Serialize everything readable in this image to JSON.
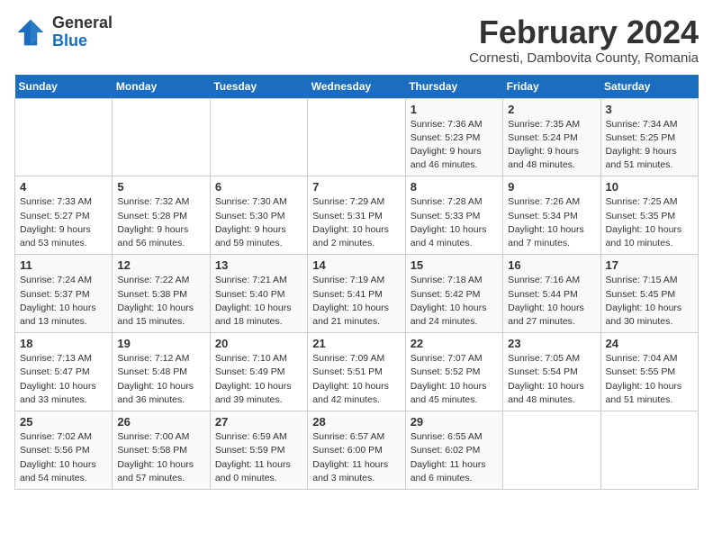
{
  "header": {
    "logo_general": "General",
    "logo_blue": "Blue",
    "month_title": "February 2024",
    "location": "Cornesti, Dambovita County, Romania"
  },
  "calendar": {
    "days_of_week": [
      "Sunday",
      "Monday",
      "Tuesday",
      "Wednesday",
      "Thursday",
      "Friday",
      "Saturday"
    ],
    "weeks": [
      [
        {
          "day": "",
          "detail": ""
        },
        {
          "day": "",
          "detail": ""
        },
        {
          "day": "",
          "detail": ""
        },
        {
          "day": "",
          "detail": ""
        },
        {
          "day": "1",
          "detail": "Sunrise: 7:36 AM\nSunset: 5:23 PM\nDaylight: 9 hours\nand 46 minutes."
        },
        {
          "day": "2",
          "detail": "Sunrise: 7:35 AM\nSunset: 5:24 PM\nDaylight: 9 hours\nand 48 minutes."
        },
        {
          "day": "3",
          "detail": "Sunrise: 7:34 AM\nSunset: 5:25 PM\nDaylight: 9 hours\nand 51 minutes."
        }
      ],
      [
        {
          "day": "4",
          "detail": "Sunrise: 7:33 AM\nSunset: 5:27 PM\nDaylight: 9 hours\nand 53 minutes."
        },
        {
          "day": "5",
          "detail": "Sunrise: 7:32 AM\nSunset: 5:28 PM\nDaylight: 9 hours\nand 56 minutes."
        },
        {
          "day": "6",
          "detail": "Sunrise: 7:30 AM\nSunset: 5:30 PM\nDaylight: 9 hours\nand 59 minutes."
        },
        {
          "day": "7",
          "detail": "Sunrise: 7:29 AM\nSunset: 5:31 PM\nDaylight: 10 hours\nand 2 minutes."
        },
        {
          "day": "8",
          "detail": "Sunrise: 7:28 AM\nSunset: 5:33 PM\nDaylight: 10 hours\nand 4 minutes."
        },
        {
          "day": "9",
          "detail": "Sunrise: 7:26 AM\nSunset: 5:34 PM\nDaylight: 10 hours\nand 7 minutes."
        },
        {
          "day": "10",
          "detail": "Sunrise: 7:25 AM\nSunset: 5:35 PM\nDaylight: 10 hours\nand 10 minutes."
        }
      ],
      [
        {
          "day": "11",
          "detail": "Sunrise: 7:24 AM\nSunset: 5:37 PM\nDaylight: 10 hours\nand 13 minutes."
        },
        {
          "day": "12",
          "detail": "Sunrise: 7:22 AM\nSunset: 5:38 PM\nDaylight: 10 hours\nand 15 minutes."
        },
        {
          "day": "13",
          "detail": "Sunrise: 7:21 AM\nSunset: 5:40 PM\nDaylight: 10 hours\nand 18 minutes."
        },
        {
          "day": "14",
          "detail": "Sunrise: 7:19 AM\nSunset: 5:41 PM\nDaylight: 10 hours\nand 21 minutes."
        },
        {
          "day": "15",
          "detail": "Sunrise: 7:18 AM\nSunset: 5:42 PM\nDaylight: 10 hours\nand 24 minutes."
        },
        {
          "day": "16",
          "detail": "Sunrise: 7:16 AM\nSunset: 5:44 PM\nDaylight: 10 hours\nand 27 minutes."
        },
        {
          "day": "17",
          "detail": "Sunrise: 7:15 AM\nSunset: 5:45 PM\nDaylight: 10 hours\nand 30 minutes."
        }
      ],
      [
        {
          "day": "18",
          "detail": "Sunrise: 7:13 AM\nSunset: 5:47 PM\nDaylight: 10 hours\nand 33 minutes."
        },
        {
          "day": "19",
          "detail": "Sunrise: 7:12 AM\nSunset: 5:48 PM\nDaylight: 10 hours\nand 36 minutes."
        },
        {
          "day": "20",
          "detail": "Sunrise: 7:10 AM\nSunset: 5:49 PM\nDaylight: 10 hours\nand 39 minutes."
        },
        {
          "day": "21",
          "detail": "Sunrise: 7:09 AM\nSunset: 5:51 PM\nDaylight: 10 hours\nand 42 minutes."
        },
        {
          "day": "22",
          "detail": "Sunrise: 7:07 AM\nSunset: 5:52 PM\nDaylight: 10 hours\nand 45 minutes."
        },
        {
          "day": "23",
          "detail": "Sunrise: 7:05 AM\nSunset: 5:54 PM\nDaylight: 10 hours\nand 48 minutes."
        },
        {
          "day": "24",
          "detail": "Sunrise: 7:04 AM\nSunset: 5:55 PM\nDaylight: 10 hours\nand 51 minutes."
        }
      ],
      [
        {
          "day": "25",
          "detail": "Sunrise: 7:02 AM\nSunset: 5:56 PM\nDaylight: 10 hours\nand 54 minutes."
        },
        {
          "day": "26",
          "detail": "Sunrise: 7:00 AM\nSunset: 5:58 PM\nDaylight: 10 hours\nand 57 minutes."
        },
        {
          "day": "27",
          "detail": "Sunrise: 6:59 AM\nSunset: 5:59 PM\nDaylight: 11 hours\nand 0 minutes."
        },
        {
          "day": "28",
          "detail": "Sunrise: 6:57 AM\nSunset: 6:00 PM\nDaylight: 11 hours\nand 3 minutes."
        },
        {
          "day": "29",
          "detail": "Sunrise: 6:55 AM\nSunset: 6:02 PM\nDaylight: 11 hours\nand 6 minutes."
        },
        {
          "day": "",
          "detail": ""
        },
        {
          "day": "",
          "detail": ""
        }
      ]
    ]
  }
}
